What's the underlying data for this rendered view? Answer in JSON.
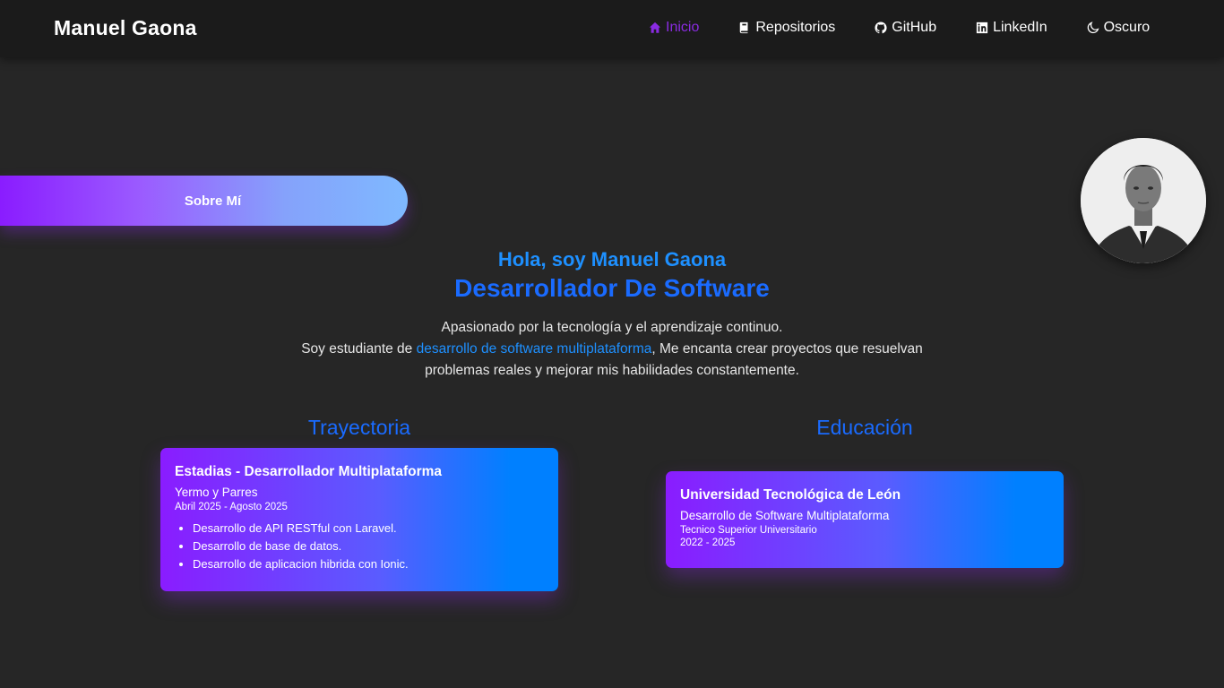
{
  "nav": {
    "brand": "Manuel Gaona",
    "items": [
      {
        "label": "Inicio",
        "icon": "home-icon"
      },
      {
        "label": "Repositorios",
        "icon": "book-icon"
      },
      {
        "label": "GitHub",
        "icon": "github-icon"
      },
      {
        "label": "LinkedIn",
        "icon": "linkedin-icon"
      },
      {
        "label": "Oscuro",
        "icon": "moon-icon"
      }
    ]
  },
  "about_button": "Sobre Mí",
  "hero": {
    "greeting": "Hola, soy Manuel Gaona",
    "role": "Desarrollador De Software",
    "line1": "Apasionado por la tecnología y el aprendizaje continuo.",
    "line2_prefix": "Soy estudiante de ",
    "line2_link": "desarrollo de software multiplataforma",
    "line2_suffix": ", Me encanta crear proyectos que resuelvan problemas reales y mejorar mis habilidades constantemente."
  },
  "trayectoria": {
    "title": "Trayectoria",
    "card": {
      "title": "Estadias - Desarrollador Multiplataforma",
      "company": "Yermo y Parres",
      "dates": "Abril 2025 - Agosto 2025",
      "items": [
        "Desarrollo de API RESTful con Laravel.",
        "Desarrollo de base de datos.",
        "Desarrollo de aplicacion hibrida con Ionic."
      ]
    }
  },
  "educacion": {
    "title": "Educación",
    "card": {
      "title": "Universidad Tecnológica de León",
      "program": "Desarrollo de Software Multiplataforma",
      "degree": "Tecnico Superior Universitario",
      "dates": "2022 - 2025"
    }
  },
  "colors": {
    "background": "#262626",
    "navbar": "#1b1b1b",
    "accent_purple": "#8a2be2",
    "accent_blue": "#1a6bff",
    "link_blue": "#1e90ff"
  }
}
